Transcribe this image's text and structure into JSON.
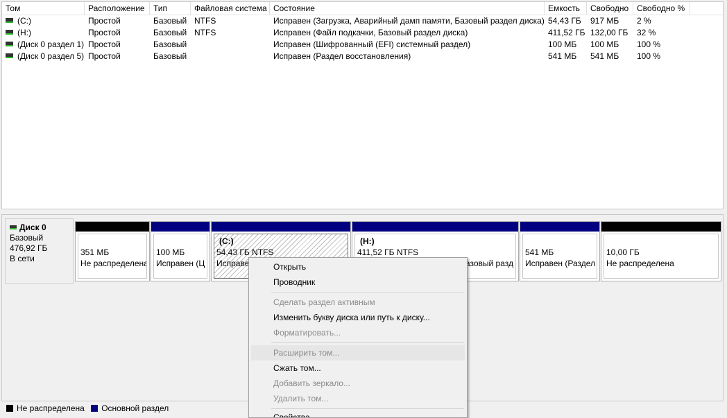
{
  "volume_list": {
    "columns": [
      "Том",
      "Расположение",
      "Тип",
      "Файловая система",
      "Состояние",
      "Емкость",
      "Свободно",
      "Свободно %"
    ],
    "rows": [
      {
        "volume": "(C:)",
        "layout": "Простой",
        "type": "Базовый",
        "fs": "NTFS",
        "status": "Исправен (Загрузка, Аварийный дамп памяти, Базовый раздел диска)",
        "capacity": "54,43 ГБ",
        "free": "917 МБ",
        "free_pct": "2 %"
      },
      {
        "volume": "(H:)",
        "layout": "Простой",
        "type": "Базовый",
        "fs": "NTFS",
        "status": "Исправен (Файл подкачки, Базовый раздел диска)",
        "capacity": "411,52 ГБ",
        "free": "132,00 ГБ",
        "free_pct": "32 %"
      },
      {
        "volume": "(Диск 0 раздел 1)",
        "layout": "Простой",
        "type": "Базовый",
        "fs": "",
        "status": "Исправен (Шифрованный (EFI) системный раздел)",
        "capacity": "100 МБ",
        "free": "100 МБ",
        "free_pct": "100 %"
      },
      {
        "volume": "(Диск 0 раздел 5)",
        "layout": "Простой",
        "type": "Базовый",
        "fs": "",
        "status": "Исправен (Раздел восстановления)",
        "capacity": "541 МБ",
        "free": "541 МБ",
        "free_pct": "100 %"
      }
    ]
  },
  "disk": {
    "name": "Диск 0",
    "type": "Базовый",
    "size": "476,92 ГБ",
    "state": "В сети",
    "partitions": [
      {
        "name": "",
        "size": "351 МБ",
        "status": "Не распределена",
        "bar_color": "#000000"
      },
      {
        "name": "",
        "size": "100 МБ",
        "status": "Исправен (Ц",
        "bar_color": "#000080"
      },
      {
        "name": "(C:)",
        "size": "54,43 ГБ NTFS",
        "status": "Исправен",
        "bar_color": "#000080"
      },
      {
        "name": "(H:)",
        "size": "411,52 ГБ NTFS",
        "status": "азовый разд",
        "bar_color": "#000080"
      },
      {
        "name": "",
        "size": "541 МБ",
        "status": "Исправен (Раздел",
        "bar_color": "#000080"
      },
      {
        "name": "",
        "size": "10,00 ГБ",
        "status": "Не распределена",
        "bar_color": "#000000"
      }
    ]
  },
  "legend": [
    {
      "label": "Не распределена",
      "color": "#000000"
    },
    {
      "label": "Основной раздел",
      "color": "#000080"
    }
  ],
  "context_menu": {
    "items": [
      {
        "label": "Открыть",
        "enabled": true
      },
      {
        "label": "Проводник",
        "enabled": true
      },
      {
        "label": "Сделать раздел активным",
        "enabled": false
      },
      {
        "label": "Изменить букву диска или путь к диску...",
        "enabled": true
      },
      {
        "label": "Форматировать...",
        "enabled": false
      },
      {
        "label": "Расширить том...",
        "enabled": false,
        "highlighted": true
      },
      {
        "label": "Сжать том...",
        "enabled": true
      },
      {
        "label": "Добавить зеркало...",
        "enabled": false
      },
      {
        "label": "Удалить том...",
        "enabled": false
      },
      {
        "label": "Свойства",
        "enabled": true
      }
    ]
  }
}
